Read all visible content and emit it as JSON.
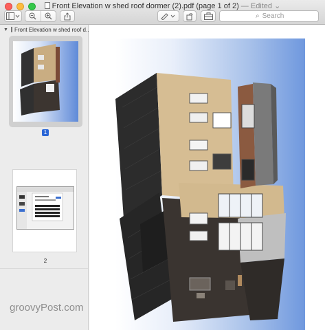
{
  "window": {
    "title": "Front Elevation w shed roof dormer (2).pdf (page 1 of 2)",
    "edited": "— Edited"
  },
  "toolbar": {
    "search_placeholder": "Search"
  },
  "sidebar": {
    "header": "Front Elevation w shed roof d...",
    "pages": [
      {
        "number": "1",
        "selected": true
      },
      {
        "number": "2",
        "selected": false
      }
    ]
  },
  "watermark": "groovyPost.com",
  "colors": {
    "selected_page_badge": "#2a66d6",
    "sky_gradient_end": "#6f98de"
  }
}
